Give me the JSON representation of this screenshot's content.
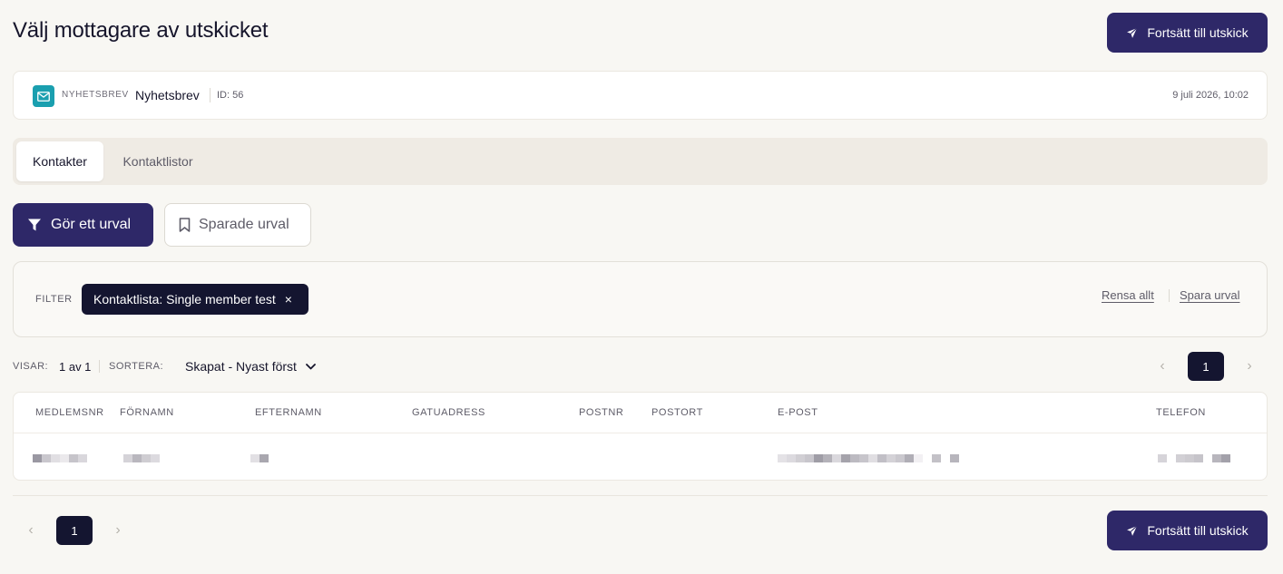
{
  "header": {
    "title": "Välj mottagare av utskicket",
    "continue_label": "Fortsätt till utskick"
  },
  "campaign": {
    "type": "NYHETSBREV",
    "name": "Nyhetsbrev",
    "id": "ID: 56",
    "date": "9 juli 2026, 10:02"
  },
  "tabs": [
    {
      "label": "Kontakter",
      "active": true
    },
    {
      "label": "Kontaktlistor",
      "active": false
    }
  ],
  "selection": {
    "make_selection_label": "Gör ett urval",
    "saved_selections_label": "Sparade urval"
  },
  "filter": {
    "label": "FILTER",
    "chip_label": "Kontaktlista: Single member test",
    "chip_remove": "×",
    "clear_all": "Rensa allt",
    "save_selection": "Spara urval"
  },
  "listing": {
    "showing_label": "VISAR:",
    "showing_value": "1 av 1",
    "sort_label": "SORTERA:",
    "sort_value": "Skapat - Nyast först"
  },
  "pagination": {
    "current_page": "1",
    "prev_icon": "‹",
    "next_icon": "›"
  },
  "table": {
    "columns": [
      "MEDLEMSNR",
      "FÖRNAMN",
      "EFTERNAMN",
      "GATUADRESS",
      "POSTNR",
      "POSTORT",
      "E-POST",
      "TELEFON"
    ]
  },
  "colors": {
    "primary": "#2e2868",
    "dark": "#141530",
    "mail_badge": "#1a9faf",
    "background": "#f8f7f3"
  },
  "icons": {
    "send": "paper-plane-icon",
    "filter": "funnel-icon",
    "bookmark": "bookmark-icon",
    "mail": "envelope-icon",
    "chevron": "chevron-down-icon"
  }
}
